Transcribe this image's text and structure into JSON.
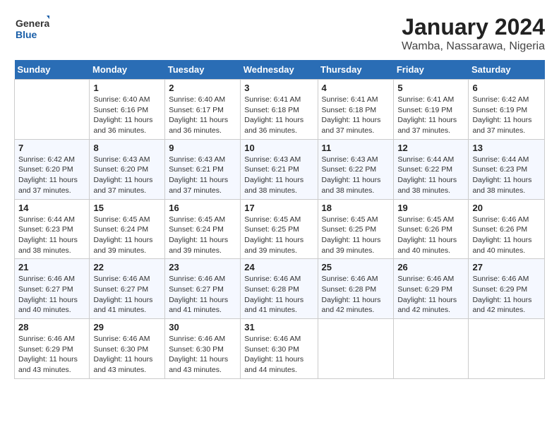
{
  "logo": {
    "text_general": "General",
    "text_blue": "Blue"
  },
  "title": "January 2024",
  "subtitle": "Wamba, Nassarawa, Nigeria",
  "days_of_week": [
    "Sunday",
    "Monday",
    "Tuesday",
    "Wednesday",
    "Thursday",
    "Friday",
    "Saturday"
  ],
  "weeks": [
    [
      {
        "day": "",
        "sunrise": "",
        "sunset": "",
        "daylight": ""
      },
      {
        "day": "1",
        "sunrise": "Sunrise: 6:40 AM",
        "sunset": "Sunset: 6:16 PM",
        "daylight": "Daylight: 11 hours and 36 minutes."
      },
      {
        "day": "2",
        "sunrise": "Sunrise: 6:40 AM",
        "sunset": "Sunset: 6:17 PM",
        "daylight": "Daylight: 11 hours and 36 minutes."
      },
      {
        "day": "3",
        "sunrise": "Sunrise: 6:41 AM",
        "sunset": "Sunset: 6:18 PM",
        "daylight": "Daylight: 11 hours and 36 minutes."
      },
      {
        "day": "4",
        "sunrise": "Sunrise: 6:41 AM",
        "sunset": "Sunset: 6:18 PM",
        "daylight": "Daylight: 11 hours and 37 minutes."
      },
      {
        "day": "5",
        "sunrise": "Sunrise: 6:41 AM",
        "sunset": "Sunset: 6:19 PM",
        "daylight": "Daylight: 11 hours and 37 minutes."
      },
      {
        "day": "6",
        "sunrise": "Sunrise: 6:42 AM",
        "sunset": "Sunset: 6:19 PM",
        "daylight": "Daylight: 11 hours and 37 minutes."
      }
    ],
    [
      {
        "day": "7",
        "sunrise": "Sunrise: 6:42 AM",
        "sunset": "Sunset: 6:20 PM",
        "daylight": "Daylight: 11 hours and 37 minutes."
      },
      {
        "day": "8",
        "sunrise": "Sunrise: 6:43 AM",
        "sunset": "Sunset: 6:20 PM",
        "daylight": "Daylight: 11 hours and 37 minutes."
      },
      {
        "day": "9",
        "sunrise": "Sunrise: 6:43 AM",
        "sunset": "Sunset: 6:21 PM",
        "daylight": "Daylight: 11 hours and 37 minutes."
      },
      {
        "day": "10",
        "sunrise": "Sunrise: 6:43 AM",
        "sunset": "Sunset: 6:21 PM",
        "daylight": "Daylight: 11 hours and 38 minutes."
      },
      {
        "day": "11",
        "sunrise": "Sunrise: 6:43 AM",
        "sunset": "Sunset: 6:22 PM",
        "daylight": "Daylight: 11 hours and 38 minutes."
      },
      {
        "day": "12",
        "sunrise": "Sunrise: 6:44 AM",
        "sunset": "Sunset: 6:22 PM",
        "daylight": "Daylight: 11 hours and 38 minutes."
      },
      {
        "day": "13",
        "sunrise": "Sunrise: 6:44 AM",
        "sunset": "Sunset: 6:23 PM",
        "daylight": "Daylight: 11 hours and 38 minutes."
      }
    ],
    [
      {
        "day": "14",
        "sunrise": "Sunrise: 6:44 AM",
        "sunset": "Sunset: 6:23 PM",
        "daylight": "Daylight: 11 hours and 38 minutes."
      },
      {
        "day": "15",
        "sunrise": "Sunrise: 6:45 AM",
        "sunset": "Sunset: 6:24 PM",
        "daylight": "Daylight: 11 hours and 39 minutes."
      },
      {
        "day": "16",
        "sunrise": "Sunrise: 6:45 AM",
        "sunset": "Sunset: 6:24 PM",
        "daylight": "Daylight: 11 hours and 39 minutes."
      },
      {
        "day": "17",
        "sunrise": "Sunrise: 6:45 AM",
        "sunset": "Sunset: 6:25 PM",
        "daylight": "Daylight: 11 hours and 39 minutes."
      },
      {
        "day": "18",
        "sunrise": "Sunrise: 6:45 AM",
        "sunset": "Sunset: 6:25 PM",
        "daylight": "Daylight: 11 hours and 39 minutes."
      },
      {
        "day": "19",
        "sunrise": "Sunrise: 6:45 AM",
        "sunset": "Sunset: 6:26 PM",
        "daylight": "Daylight: 11 hours and 40 minutes."
      },
      {
        "day": "20",
        "sunrise": "Sunrise: 6:46 AM",
        "sunset": "Sunset: 6:26 PM",
        "daylight": "Daylight: 11 hours and 40 minutes."
      }
    ],
    [
      {
        "day": "21",
        "sunrise": "Sunrise: 6:46 AM",
        "sunset": "Sunset: 6:27 PM",
        "daylight": "Daylight: 11 hours and 40 minutes."
      },
      {
        "day": "22",
        "sunrise": "Sunrise: 6:46 AM",
        "sunset": "Sunset: 6:27 PM",
        "daylight": "Daylight: 11 hours and 41 minutes."
      },
      {
        "day": "23",
        "sunrise": "Sunrise: 6:46 AM",
        "sunset": "Sunset: 6:27 PM",
        "daylight": "Daylight: 11 hours and 41 minutes."
      },
      {
        "day": "24",
        "sunrise": "Sunrise: 6:46 AM",
        "sunset": "Sunset: 6:28 PM",
        "daylight": "Daylight: 11 hours and 41 minutes."
      },
      {
        "day": "25",
        "sunrise": "Sunrise: 6:46 AM",
        "sunset": "Sunset: 6:28 PM",
        "daylight": "Daylight: 11 hours and 42 minutes."
      },
      {
        "day": "26",
        "sunrise": "Sunrise: 6:46 AM",
        "sunset": "Sunset: 6:29 PM",
        "daylight": "Daylight: 11 hours and 42 minutes."
      },
      {
        "day": "27",
        "sunrise": "Sunrise: 6:46 AM",
        "sunset": "Sunset: 6:29 PM",
        "daylight": "Daylight: 11 hours and 42 minutes."
      }
    ],
    [
      {
        "day": "28",
        "sunrise": "Sunrise: 6:46 AM",
        "sunset": "Sunset: 6:29 PM",
        "daylight": "Daylight: 11 hours and 43 minutes."
      },
      {
        "day": "29",
        "sunrise": "Sunrise: 6:46 AM",
        "sunset": "Sunset: 6:30 PM",
        "daylight": "Daylight: 11 hours and 43 minutes."
      },
      {
        "day": "30",
        "sunrise": "Sunrise: 6:46 AM",
        "sunset": "Sunset: 6:30 PM",
        "daylight": "Daylight: 11 hours and 43 minutes."
      },
      {
        "day": "31",
        "sunrise": "Sunrise: 6:46 AM",
        "sunset": "Sunset: 6:30 PM",
        "daylight": "Daylight: 11 hours and 44 minutes."
      },
      {
        "day": "",
        "sunrise": "",
        "sunset": "",
        "daylight": ""
      },
      {
        "day": "",
        "sunrise": "",
        "sunset": "",
        "daylight": ""
      },
      {
        "day": "",
        "sunrise": "",
        "sunset": "",
        "daylight": ""
      }
    ]
  ]
}
